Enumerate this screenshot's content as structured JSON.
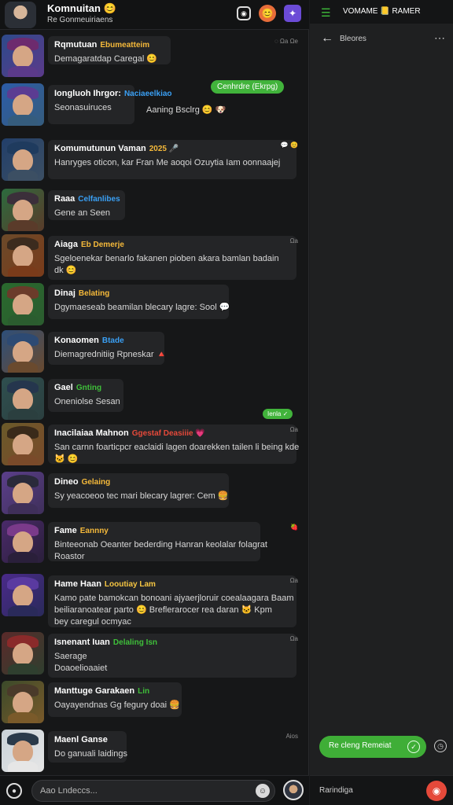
{
  "header": {
    "title": "Komnuitan",
    "title_emoji": "😊",
    "subtitle": "Re Gonmeuiriaens",
    "icons": [
      "screen-icon",
      "reaction-icon",
      "apps-icon"
    ]
  },
  "feed": [
    {
      "name": "Rqmutuan",
      "tag": "Ebumeatteim",
      "message": "Demagaratdap Caregal 😊",
      "meta": "◌ Ωa Ωe",
      "tag_color": "#f5b93a"
    },
    {
      "name": "Iongluoh Ihrgor:",
      "tag": "Naciaeelkiao",
      "message": "Seonasuiruces",
      "meta": "",
      "tag_color": "#3aa0f5",
      "side_text": "Aaning Bsclrg 😊 🐶",
      "pill": "Cenhrdre (Ekrpg)"
    },
    {
      "name": "Komumutunun Vaman",
      "tag": "2025 🎤",
      "message": "Hanryges oticon, kar Fran Me aoqoi Ozuytia Iam oonnaajej",
      "meta": "💬 😊",
      "tag_color": "#f5b93a"
    },
    {
      "name": "Raaa",
      "tag": "Celfanlibes",
      "message": "Gene an Seen",
      "meta": "",
      "tag_color": "#3aa0f5"
    },
    {
      "name": "Aiaga",
      "tag": "Eb Demerje",
      "message": "Sgeloenekar benarlo fakanen pioben akara bamlan badain",
      "message2": "dk 😊",
      "meta": "Ωa",
      "tag_color": "#f5b93a"
    },
    {
      "name": "Dinaj",
      "tag": "Belating",
      "message": "Dgymaeseab beamilan blecary lagre: Sool 💬",
      "meta": "",
      "tag_color": "#f5b93a"
    },
    {
      "name": "Konaomen",
      "tag": "Btade",
      "message": "Diemagrednitiig Rpneskar 🔺",
      "meta": "",
      "tag_color": "#3aa0f5"
    },
    {
      "name": "Gael",
      "tag": "Gnting",
      "message": "Oneniolse Sesan",
      "meta": "",
      "tag_color": "#3fbf3a",
      "pill": "Ienla ✓"
    },
    {
      "name": "Inacilaiaa Mahnon",
      "tag": "Ggestaf Deasiiie 💗",
      "message": "San carnn foarticpcr eaclaidi lagen doarekken tailen li being kde",
      "message2": "🐱 😊",
      "meta": "Ωa",
      "tag_color": "#e5493a"
    },
    {
      "name": "Dineo",
      "tag": "Gelaing",
      "message": "Sy yeacoeoo tec mari blecary lagrer: Cem 🍔",
      "meta": "",
      "tag_color": "#f5b93a"
    },
    {
      "name": "Fame",
      "tag": "Eannny",
      "message": "Binteeonab Oeanter bederding Hanran keolalar folagrat",
      "message2": "Roastor",
      "meta": "🍓",
      "tag_color": "#f5b93a"
    },
    {
      "name": "Hame Haan",
      "tag": "Looutiay Lam",
      "message": "Kamo pate bamokcan bonoani ajyaerjloruir coealaagara Baam",
      "message2": "beiliaranoatear parto 😊 Breflerarocer rea daran 🐱 Kpm",
      "message3": "bey caregul ocmyac",
      "meta": "Ωa",
      "tag_color": "#f5c542"
    },
    {
      "name": "Isnenant Iuan",
      "tag": "Delaling Isn",
      "message": "Saerage",
      "message2": "Doaoelioaaiet",
      "meta": "Ωa",
      "tag_color": "#3fbf3a"
    },
    {
      "name": "Manttuge Garakaen",
      "tag": "Lin",
      "message": "Oayayendnas Gg fegury doai 🍔",
      "meta": "",
      "tag_color": "#3fbf3a"
    },
    {
      "name": "Maenl Ganse",
      "tag": "",
      "message": "Do ganuali laidings",
      "meta": "Aios",
      "tag_color": "#3aa0f5"
    }
  ],
  "composer": {
    "placeholder": "Aao Lndeccs..."
  },
  "right": {
    "top_title": "VOMAME 📒 RAMER",
    "header_title": "Bleores",
    "button_label": "Re cleng Remeiat",
    "bottom_text": "Rarindiga"
  }
}
